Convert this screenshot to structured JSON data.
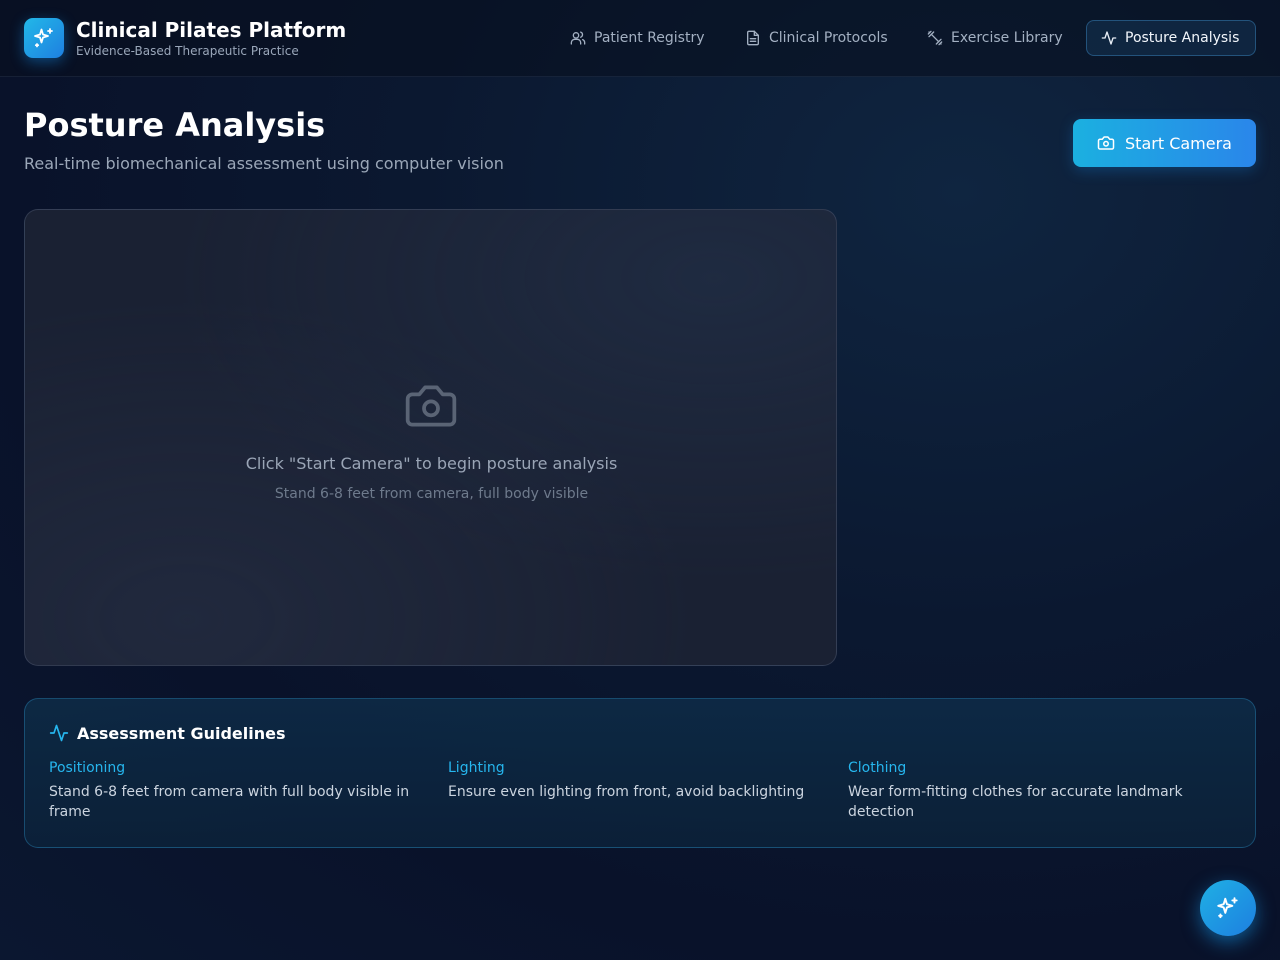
{
  "app": {
    "title": "Clinical Pilates Platform",
    "subtitle": "Evidence-Based Therapeutic Practice",
    "logo_icon": "sparkles-icon"
  },
  "nav": {
    "items": [
      {
        "label": "Patient Registry",
        "icon": "users-icon",
        "active": false
      },
      {
        "label": "Clinical Protocols",
        "icon": "file-text-icon",
        "active": false
      },
      {
        "label": "Exercise Library",
        "icon": "dumbbell-icon",
        "active": false
      },
      {
        "label": "Posture Analysis",
        "icon": "activity-icon",
        "active": true
      }
    ]
  },
  "page": {
    "title": "Posture Analysis",
    "subtitle": "Real-time biomechanical assessment using computer vision",
    "start_button_label": "Start Camera"
  },
  "camera": {
    "message": "Click \"Start Camera\" to begin posture analysis",
    "hint": "Stand 6-8 feet from camera, full body visible",
    "icon": "camera-icon"
  },
  "guidelines": {
    "title": "Assessment Guidelines",
    "items": [
      {
        "label": "Positioning",
        "text": "Stand 6-8 feet from camera with full body visible in frame"
      },
      {
        "label": "Lighting",
        "text": "Ensure even lighting from front, avoid backlighting"
      },
      {
        "label": "Clothing",
        "text": "Wear form-fitting clothes for accurate landmark detection"
      }
    ]
  },
  "fab": {
    "icon": "sparkles-icon"
  },
  "colors": {
    "accent": "#1fb0e4",
    "accent_label": "#26b6ee",
    "background": "#0b1830",
    "panel": "#1a2133"
  }
}
